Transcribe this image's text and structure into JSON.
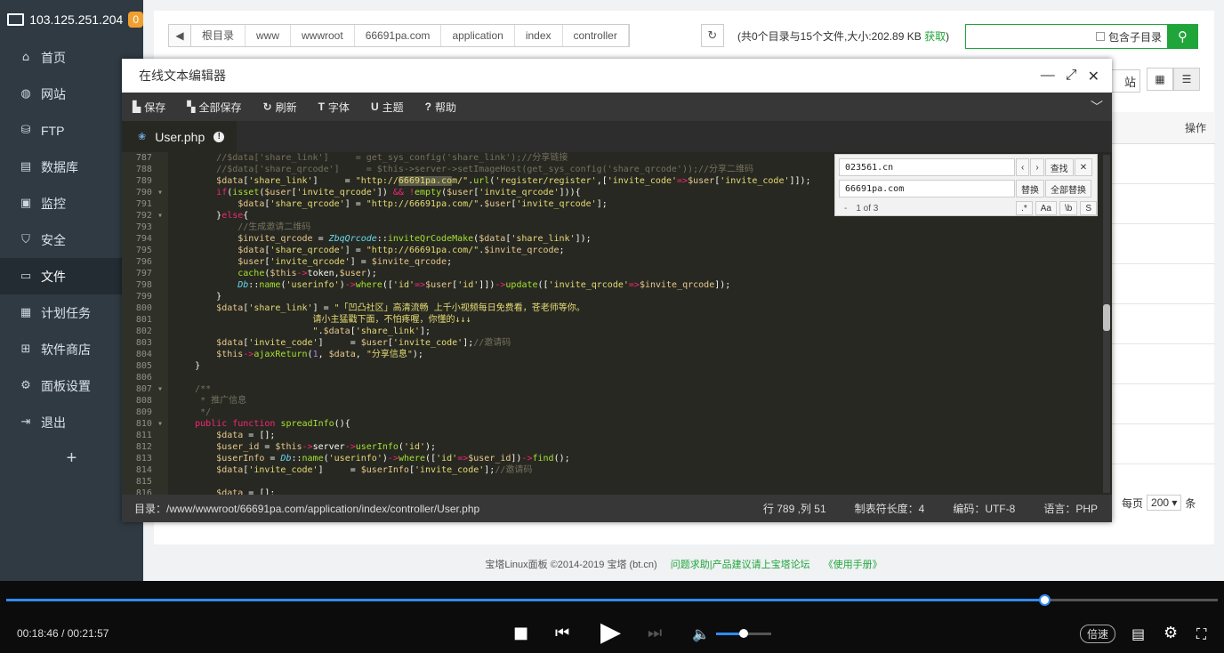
{
  "server": {
    "ip": "103.125.251.204",
    "badge": "0"
  },
  "sidebar": {
    "items": [
      {
        "label": "首页",
        "icon": "home-icon",
        "glyph": "⌂",
        "active": false
      },
      {
        "label": "网站",
        "icon": "globe-icon",
        "glyph": "◍",
        "active": false
      },
      {
        "label": "FTP",
        "icon": "ftp-icon",
        "glyph": "⛁",
        "active": false
      },
      {
        "label": "数据库",
        "icon": "database-icon",
        "glyph": "▤",
        "active": false
      },
      {
        "label": "监控",
        "icon": "monitor-icon",
        "glyph": "▣",
        "active": false
      },
      {
        "label": "安全",
        "icon": "shield-icon",
        "glyph": "⛉",
        "active": false
      },
      {
        "label": "文件",
        "icon": "folder-icon",
        "glyph": "▭",
        "active": true
      },
      {
        "label": "计划任务",
        "icon": "calendar-icon",
        "glyph": "▦",
        "active": false
      },
      {
        "label": "软件商店",
        "icon": "apps-icon",
        "glyph": "⊞",
        "active": false
      },
      {
        "label": "面板设置",
        "icon": "gear-icon",
        "glyph": "⚙",
        "active": false
      },
      {
        "label": "退出",
        "icon": "logout-icon",
        "glyph": "⇥",
        "active": false
      }
    ],
    "add": "+"
  },
  "filebar": {
    "crumbs": [
      "根目录",
      "www",
      "wwwroot",
      "66691pa.com",
      "application",
      "index",
      "controller"
    ],
    "info_prefix": "(共0个目录与15个文件,大小:202.89 KB ",
    "info_link": "获取",
    "info_suffix": ")",
    "include_subdir": "包含子目录"
  },
  "right": {
    "partial_label": "站",
    "op_header": "操作",
    "per_page_label": "每页",
    "per_page": "200",
    "unit": "条"
  },
  "footer": {
    "copyright": "宝塔Linux面板 ©2014-2019 宝塔 (bt.cn)",
    "help": "问题求助|产品建议请上宝塔论坛",
    "manual": "《使用手册》"
  },
  "editor": {
    "title": "在线文本编辑器",
    "toolbar": [
      {
        "icon": "save-icon",
        "glyph": "▙",
        "label": "保存"
      },
      {
        "icon": "save-all-icon",
        "glyph": "▚",
        "label": "全部保存"
      },
      {
        "icon": "refresh-icon",
        "glyph": "↻",
        "label": "刷新"
      },
      {
        "icon": "font-icon",
        "glyph": "T",
        "label": "字体"
      },
      {
        "icon": "theme-icon",
        "glyph": "U",
        "label": "主题"
      },
      {
        "icon": "help-icon",
        "glyph": "?",
        "label": "帮助"
      }
    ],
    "tab": "User.php",
    "find": {
      "search": "023561.cn",
      "replace": "66691pa.com",
      "find_btn": "查找",
      "replace_btn": "替换",
      "replace_all_btn": "全部替换",
      "count": "1 of 3",
      "opts": [
        ".*",
        "Aa",
        "\\b",
        "S"
      ]
    },
    "code": [
      {
        "n": "787",
        "fold": false,
        "h": "        <span class=\"c-cm\">//$data['share_link']     = get_sys_config('share_link');//分享链接</span>"
      },
      {
        "n": "788",
        "fold": false,
        "h": "        <span class=\"c-cm\">//$data['share_qrcode']     = $this->server->setImageHost(get_sys_config('share_qrcode'));//分享二维码</span>"
      },
      {
        "n": "789",
        "fold": false,
        "h": "        <span class=\"c-va\">$data</span>[<span class=\"c-st\">'share_link'</span>]     = <span class=\"c-st\">\"http://<span class=\"hl\">66691pa.co</span>m/\"</span>.<span class=\"c-fn\">url</span>(<span class=\"c-st\">'register/register'</span>,[<span class=\"c-st\">'invite_code'</span><span class=\"c-kw\">=></span><span class=\"c-va\">$user</span>[<span class=\"c-st\">'invite_code'</span>]]);"
      },
      {
        "n": "790",
        "fold": true,
        "h": "        <span class=\"c-kw\">if</span>(<span class=\"c-fn\">isset</span>(<span class=\"c-va\">$user</span>[<span class=\"c-st\">'invite_qrcode'</span>]) <span class=\"c-kw\">&amp;&amp;</span> <span class=\"c-kw\">!</span><span class=\"c-fn\">empty</span>(<span class=\"c-va\">$user</span>[<span class=\"c-st\">'invite_qrcode'</span>])){"
      },
      {
        "n": "791",
        "fold": false,
        "h": "            <span class=\"c-va\">$data</span>[<span class=\"c-st\">'share_qrcode'</span>] = <span class=\"c-st\">\"http://66691pa.com/\"</span>.<span class=\"c-va\">$user</span>[<span class=\"c-st\">'invite_qrcode'</span>];"
      },
      {
        "n": "792",
        "fold": true,
        "h": "        }<span class=\"c-kw\">else</span>{"
      },
      {
        "n": "793",
        "fold": false,
        "h": "            <span class=\"c-cm\">//生成邀请二维码</span>"
      },
      {
        "n": "794",
        "fold": false,
        "h": "            <span class=\"c-va\">$invite_qrcode</span> = <span class=\"c-ty\">ZbqQrcode</span>::<span class=\"c-fn\">inviteQrCodeMake</span>(<span class=\"c-va\">$data</span>[<span class=\"c-st\">'share_link'</span>]);"
      },
      {
        "n": "795",
        "fold": false,
        "h": "            <span class=\"c-va\">$data</span>[<span class=\"c-st\">'share_qrcode'</span>] = <span class=\"c-st\">\"http://66691pa.com/\"</span>.<span class=\"c-va\">$invite_qrcode</span>;"
      },
      {
        "n": "796",
        "fold": false,
        "h": "            <span class=\"c-va\">$user</span>[<span class=\"c-st\">'invite_qrcode'</span>] = <span class=\"c-va\">$invite_qrcode</span>;"
      },
      {
        "n": "797",
        "fold": false,
        "h": "            <span class=\"c-fn\">cache</span>(<span class=\"c-va\">$this</span><span class=\"c-kw\">-></span>token,<span class=\"c-va\">$user</span>);"
      },
      {
        "n": "798",
        "fold": false,
        "h": "            <span class=\"c-ty\">Db</span>::<span class=\"c-fn\">name</span>(<span class=\"c-st\">'userinfo'</span>)<span class=\"c-kw\">-></span><span class=\"c-fn\">where</span>([<span class=\"c-st\">'id'</span><span class=\"c-kw\">=></span><span class=\"c-va\">$user</span>[<span class=\"c-st\">'id'</span>]])<span class=\"c-kw\">-></span><span class=\"c-fn\">update</span>([<span class=\"c-st\">'invite_qrcode'</span><span class=\"c-kw\">=></span><span class=\"c-va\">$invite_qrcode</span>]);"
      },
      {
        "n": "799",
        "fold": false,
        "h": "        }"
      },
      {
        "n": "800",
        "fold": false,
        "h": "        <span class=\"c-va\">$data</span>[<span class=\"c-st\">'share_link'</span>] = <span class=\"c-st\">\"「凹凸社区」高清流畅 上千小视频每日免费看，苍老师等你。</span>"
      },
      {
        "n": "801",
        "fold": false,
        "h": "<span class=\"c-st\">                          请小主猛戳下面，不怕疼喔，你懂的↓↓↓</span>"
      },
      {
        "n": "802",
        "fold": false,
        "h": "<span class=\"c-st\">                          \"</span>.<span class=\"c-va\">$data</span>[<span class=\"c-st\">'share_link'</span>];"
      },
      {
        "n": "803",
        "fold": false,
        "h": "        <span class=\"c-va\">$data</span>[<span class=\"c-st\">'invite_code'</span>]     = <span class=\"c-va\">$user</span>[<span class=\"c-st\">'invite_code'</span>];<span class=\"c-cm\">//邀请码</span>"
      },
      {
        "n": "804",
        "fold": false,
        "h": "        <span class=\"c-va\">$this</span><span class=\"c-kw\">-></span><span class=\"c-fn\">ajaxReturn</span>(<span class=\"c-nm\">1</span>, <span class=\"c-va\">$data</span>, <span class=\"c-st\">\"分享信息\"</span>);"
      },
      {
        "n": "805",
        "fold": false,
        "h": "    }"
      },
      {
        "n": "806",
        "fold": false,
        "h": ""
      },
      {
        "n": "807",
        "fold": true,
        "h": "    <span class=\"c-cm\">/**</span>"
      },
      {
        "n": "808",
        "fold": false,
        "h": "<span class=\"c-cm\">     * 推广信息</span>"
      },
      {
        "n": "809",
        "fold": false,
        "h": "<span class=\"c-cm\">     */</span>"
      },
      {
        "n": "810",
        "fold": true,
        "h": "    <span class=\"c-kw\">public</span> <span class=\"c-kw\">function</span> <span class=\"c-fn\">spreadInfo</span>(){"
      },
      {
        "n": "811",
        "fold": false,
        "h": "        <span class=\"c-va\">$data</span> = [];"
      },
      {
        "n": "812",
        "fold": false,
        "h": "        <span class=\"c-va\">$user_id</span> = <span class=\"c-va\">$this</span><span class=\"c-kw\">-></span>server<span class=\"c-kw\">-></span><span class=\"c-fn\">userInfo</span>(<span class=\"c-st\">'id'</span>);"
      },
      {
        "n": "813",
        "fold": false,
        "h": "        <span class=\"c-va\">$userInfo</span> = <span class=\"c-ty\">Db</span>::<span class=\"c-fn\">name</span>(<span class=\"c-st\">'userinfo'</span>)<span class=\"c-kw\">-></span><span class=\"c-fn\">where</span>([<span class=\"c-st\">'id'</span><span class=\"c-kw\">=></span><span class=\"c-va\">$user_id</span>])<span class=\"c-kw\">-></span><span class=\"c-fn\">find</span>();"
      },
      {
        "n": "814",
        "fold": false,
        "h": "        <span class=\"c-va\">$data</span>[<span class=\"c-st\">'invite_code'</span>]     = <span class=\"c-va\">$userInfo</span>[<span class=\"c-st\">'invite_code'</span>];<span class=\"c-cm\">//邀请码</span>"
      },
      {
        "n": "815",
        "fold": false,
        "h": ""
      },
      {
        "n": "816",
        "fold": false,
        "h": "        <span class=\"c-va\">$data</span> = [];"
      }
    ],
    "status": {
      "path_label": "目录：",
      "path": "/www/wwwroot/66691pa.com/application/index/controller/User.php",
      "position": "行 789 ,列 51",
      "tab_size": "制表符长度：4",
      "encoding": "编码：UTF-8",
      "language": "语言：PHP"
    }
  },
  "player": {
    "current": "00:18:46",
    "sep": "/",
    "total": "00:21:57",
    "progress": 0.857,
    "volume": 0.5,
    "speed_label": "倍速"
  }
}
